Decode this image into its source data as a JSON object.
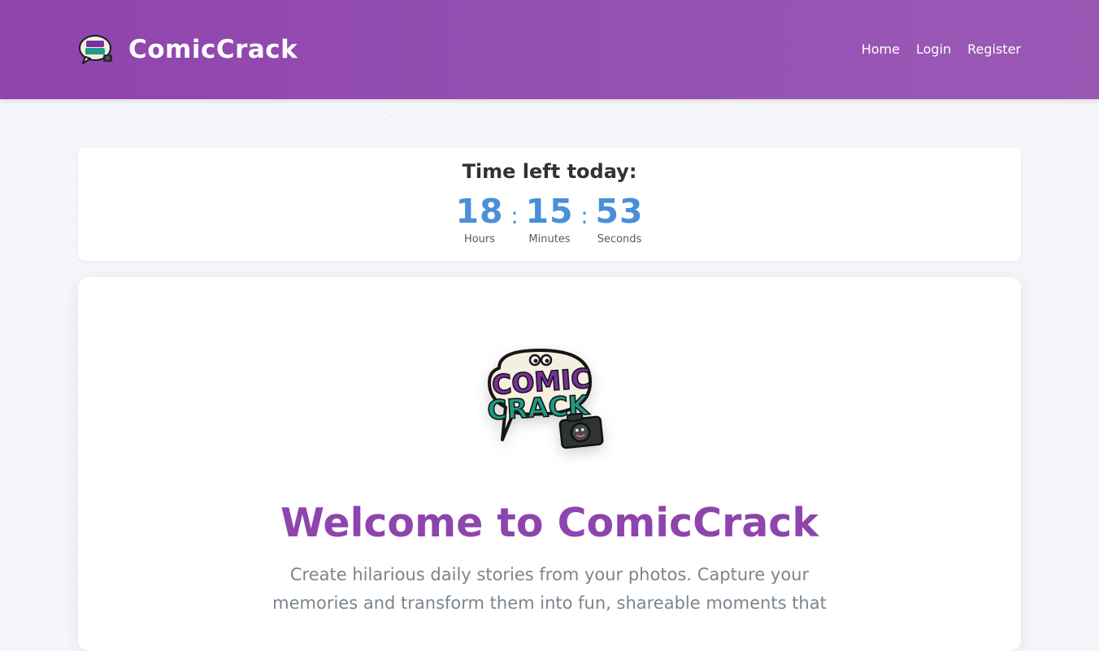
{
  "header": {
    "brand_name": "ComicCrack",
    "logo_icon": "comic-crack-logo-icon",
    "nav": {
      "home": "Home",
      "login": "Login",
      "register": "Register"
    },
    "colors": {
      "gradient_start": "#8e44ad",
      "gradient_end": "#9b59b6"
    }
  },
  "timer": {
    "title": "Time left today:",
    "hours": "18",
    "hours_label": "Hours",
    "minutes": "15",
    "minutes_label": "Minutes",
    "seconds": "53",
    "seconds_label": "Seconds",
    "separator": ":",
    "accent_color": "#4a8fd8"
  },
  "hero": {
    "logo_icon": "comic-crack-speech-bubble-camera-icon",
    "logo_text": [
      "COMIC",
      "CRACK"
    ],
    "title": "Welcome to ComicCrack",
    "description": "Create hilarious daily stories from your photos. Capture your memories and transform them into fun, shareable moments that",
    "title_color": "#8e44ad"
  }
}
